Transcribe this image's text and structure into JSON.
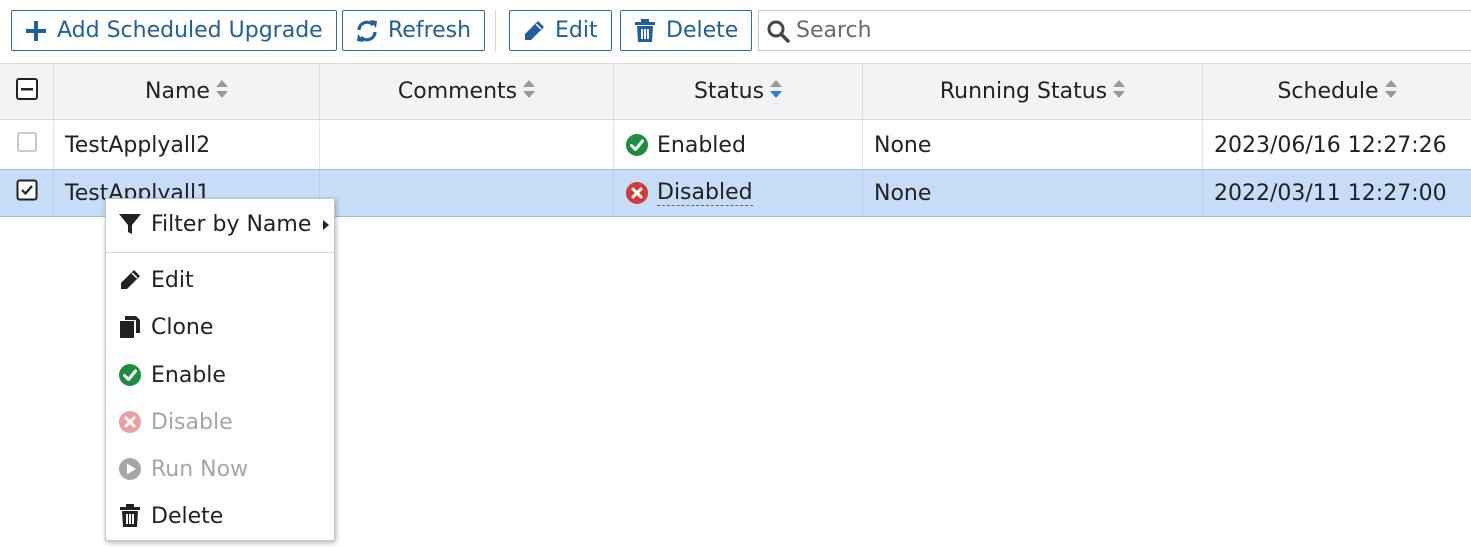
{
  "toolbar": {
    "add_label": "Add Scheduled Upgrade",
    "refresh_label": "Refresh",
    "edit_label": "Edit",
    "delete_label": "Delete",
    "search_placeholder": "Search"
  },
  "table": {
    "columns": [
      "Name",
      "Comments",
      "Status",
      "Running Status",
      "Schedule"
    ],
    "sorted_column": "Status",
    "rows": [
      {
        "checked": false,
        "selected": false,
        "name": "TestApplyall2",
        "comments": "",
        "status": "Enabled",
        "status_icon": "check-circle-icon",
        "running_status": "None",
        "schedule": "2023/06/16 12:27:26"
      },
      {
        "checked": true,
        "selected": true,
        "name": "TestApplyall1",
        "comments": "",
        "status": "Disabled",
        "status_icon": "x-circle-icon",
        "running_status": "None",
        "schedule": "2022/03/11 12:27:00"
      }
    ]
  },
  "context_menu": {
    "items": [
      {
        "label": "Filter by Name",
        "icon": "filter-icon",
        "submenu": true,
        "disabled": false
      },
      {
        "label": "Edit",
        "icon": "pencil-icon",
        "disabled": false
      },
      {
        "label": "Clone",
        "icon": "clone-icon",
        "disabled": false
      },
      {
        "label": "Enable",
        "icon": "check-circle-icon",
        "disabled": false
      },
      {
        "label": "Disable",
        "icon": "x-circle-icon",
        "disabled": true
      },
      {
        "label": "Run Now",
        "icon": "play-circle-icon",
        "disabled": true
      },
      {
        "label": "Delete",
        "icon": "trash-icon",
        "disabled": false
      }
    ]
  },
  "colors": {
    "accent": "#2d6ea8",
    "selected_row": "#c6dcf7",
    "enabled_green": "#1e8e3e",
    "disabled_red": "#d33b3b",
    "header_bg": "#f3f3f3"
  }
}
